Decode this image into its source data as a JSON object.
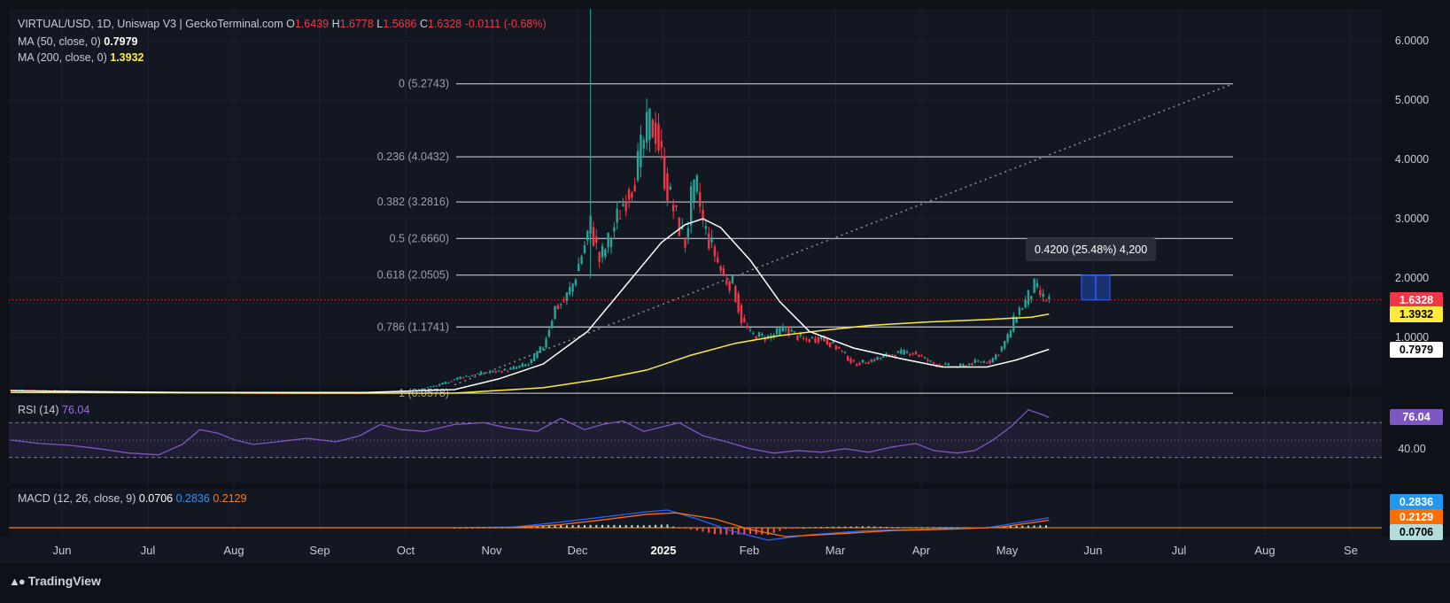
{
  "header": {
    "symbol": "VIRTUAL/USD, 1D, Uniswap V3 | GeckoTerminal.com",
    "ohlc": [
      {
        "k": "O",
        "v": "1.6439"
      },
      {
        "k": "H",
        "v": "1.6778"
      },
      {
        "k": "L",
        "v": "1.5686"
      },
      {
        "k": "C",
        "v": "1.6328"
      }
    ],
    "change": "-0.0111 (-0.68%)",
    "ma50_label": "MA (50, close, 0)",
    "ma50_value": "0.7979",
    "ma200_label": "MA (200, close, 0)",
    "ma200_value": "1.3932"
  },
  "rsi_panel": {
    "label": "RSI (14)",
    "value": "76.04"
  },
  "macd_panel": {
    "label": "MACD (12, 26, close, 9)",
    "macd": "0.0706",
    "signal": "0.2836",
    "hist": "0.2129"
  },
  "measure_tooltip": "0.4200 (25.48%) 4,200",
  "brand": "TradingView",
  "colors": {
    "up": "#26a69a",
    "down": "#f23645",
    "ma50": "#ffffff",
    "ma200": "#ffeb3b",
    "rsi": "#7e57c2",
    "macd": "#2962ff",
    "signal": "#ff6d00",
    "fib": "#b2b5be"
  },
  "chart_data": {
    "type": "candlestick",
    "timeframe": "1D",
    "x_ticks": [
      "Jun",
      "Jul",
      "Aug",
      "Sep",
      "Oct",
      "Nov",
      "Dec",
      "2025",
      "Feb",
      "Mar",
      "Apr",
      "May",
      "Jun",
      "Jul",
      "Aug",
      "Se"
    ],
    "y_ticks": [
      "6.0000",
      "5.0000",
      "4.0000",
      "3.0000",
      "2.0000",
      "1.0000"
    ],
    "last_price": "1.6328",
    "axis_tags": [
      {
        "value": "1.6328",
        "bg": "#f23645",
        "fg": "#ffffff"
      },
      {
        "value": "1.3932",
        "bg": "#ffeb3b",
        "fg": "#000000"
      },
      {
        "value": "0.7979",
        "bg": "#ffffff",
        "fg": "#000000"
      }
    ],
    "fib_levels": [
      {
        "label": "0 (5.2743)",
        "value": 5.2743
      },
      {
        "label": "0.236 (4.0432)",
        "value": 4.0432
      },
      {
        "label": "0.382 (3.2816)",
        "value": 3.2816
      },
      {
        "label": "0.5 (2.6660)",
        "value": 2.666
      },
      {
        "label": "0.618 (2.0505)",
        "value": 2.0505
      },
      {
        "label": "0.786 (1.1741)",
        "value": 1.1741
      },
      {
        "label": "1 (0.0578)",
        "value": 0.0578
      }
    ],
    "price_path": [
      [
        0,
        0.12
      ],
      [
        30,
        0.09
      ],
      [
        60,
        0.07
      ],
      [
        90,
        0.06
      ],
      [
        120,
        0.06
      ],
      [
        135,
        0.09
      ],
      [
        145,
        0.2
      ],
      [
        152,
        0.33
      ],
      [
        160,
        0.4
      ],
      [
        168,
        0.45
      ],
      [
        175,
        0.55
      ],
      [
        180,
        0.85
      ],
      [
        184,
        1.5
      ],
      [
        187,
        1.6
      ],
      [
        190,
        1.9
      ],
      [
        193,
        2.4
      ],
      [
        196,
        2.9
      ],
      [
        199,
        2.3
      ],
      [
        202,
        2.6
      ],
      [
        205,
        3.0
      ],
      [
        208,
        3.4
      ],
      [
        210,
        3.6
      ],
      [
        212,
        3.9
      ],
      [
        214,
        4.3
      ],
      [
        216,
        4.6
      ],
      [
        218,
        4.5
      ],
      [
        220,
        4.0
      ],
      [
        222,
        3.5
      ],
      [
        225,
        3.0
      ],
      [
        228,
        2.6
      ],
      [
        230,
        3.3
      ],
      [
        232,
        3.5
      ],
      [
        234,
        2.9
      ],
      [
        238,
        2.4
      ],
      [
        241,
        2.0
      ],
      [
        244,
        1.9
      ],
      [
        247,
        1.3
      ],
      [
        250,
        1.05
      ],
      [
        256,
        1.0
      ],
      [
        262,
        1.15
      ],
      [
        268,
        0.95
      ],
      [
        274,
        1.0
      ],
      [
        280,
        0.8
      ],
      [
        285,
        0.55
      ],
      [
        290,
        0.6
      ],
      [
        298,
        0.72
      ],
      [
        305,
        0.75
      ],
      [
        312,
        0.55
      ],
      [
        320,
        0.5
      ],
      [
        326,
        0.58
      ],
      [
        331,
        0.6
      ],
      [
        334,
        0.75
      ],
      [
        337,
        1.0
      ],
      [
        340,
        1.4
      ],
      [
        343,
        1.6
      ],
      [
        346,
        1.85
      ],
      [
        349,
        1.65
      ],
      [
        351,
        1.6328
      ]
    ],
    "ma50_path": [
      [
        0,
        0.1
      ],
      [
        60,
        0.07
      ],
      [
        120,
        0.07
      ],
      [
        150,
        0.12
      ],
      [
        165,
        0.3
      ],
      [
        180,
        0.55
      ],
      [
        195,
        1.1
      ],
      [
        210,
        2.0
      ],
      [
        220,
        2.6
      ],
      [
        228,
        2.9
      ],
      [
        234,
        3.0
      ],
      [
        240,
        2.85
      ],
      [
        250,
        2.3
      ],
      [
        260,
        1.6
      ],
      [
        270,
        1.1
      ],
      [
        285,
        0.82
      ],
      [
        300,
        0.65
      ],
      [
        315,
        0.5
      ],
      [
        330,
        0.5
      ],
      [
        340,
        0.62
      ],
      [
        351,
        0.7979
      ]
    ],
    "ma200_path": [
      [
        0,
        0.07
      ],
      [
        100,
        0.06
      ],
      [
        150,
        0.06
      ],
      [
        180,
        0.15
      ],
      [
        200,
        0.3
      ],
      [
        215,
        0.45
      ],
      [
        230,
        0.7
      ],
      [
        245,
        0.9
      ],
      [
        260,
        1.03
      ],
      [
        275,
        1.12
      ],
      [
        290,
        1.2
      ],
      [
        310,
        1.26
      ],
      [
        330,
        1.3
      ],
      [
        345,
        1.34
      ],
      [
        351,
        1.3932
      ]
    ],
    "rsi": {
      "value": 76.04,
      "ticks": [
        "40.00"
      ],
      "upper": 70,
      "lower": 30,
      "path": [
        [
          0,
          50
        ],
        [
          10,
          46
        ],
        [
          20,
          44
        ],
        [
          30,
          40
        ],
        [
          40,
          35
        ],
        [
          50,
          33
        ],
        [
          58,
          45
        ],
        [
          64,
          62
        ],
        [
          70,
          58
        ],
        [
          76,
          50
        ],
        [
          82,
          45
        ],
        [
          90,
          48
        ],
        [
          100,
          52
        ],
        [
          110,
          48
        ],
        [
          118,
          55
        ],
        [
          125,
          68
        ],
        [
          132,
          62
        ],
        [
          140,
          60
        ],
        [
          150,
          68
        ],
        [
          160,
          70
        ],
        [
          168,
          64
        ],
        [
          178,
          60
        ],
        [
          186,
          75
        ],
        [
          194,
          62
        ],
        [
          200,
          68
        ],
        [
          207,
          72
        ],
        [
          214,
          60
        ],
        [
          220,
          65
        ],
        [
          226,
          70
        ],
        [
          234,
          55
        ],
        [
          242,
          48
        ],
        [
          250,
          40
        ],
        [
          258,
          35
        ],
        [
          266,
          38
        ],
        [
          274,
          36
        ],
        [
          282,
          40
        ],
        [
          290,
          36
        ],
        [
          298,
          42
        ],
        [
          306,
          46
        ],
        [
          312,
          38
        ],
        [
          320,
          35
        ],
        [
          326,
          38
        ],
        [
          332,
          50
        ],
        [
          338,
          65
        ],
        [
          344,
          85
        ],
        [
          349,
          79
        ],
        [
          351,
          76.04
        ]
      ]
    },
    "macd": {
      "macd_value": 0.0706,
      "signal_value": 0.2836,
      "hist_value": 0.2129,
      "macd_path": [
        [
          0,
          0
        ],
        [
          150,
          0
        ],
        [
          170,
          0.02
        ],
        [
          185,
          0.15
        ],
        [
          200,
          0.3
        ],
        [
          215,
          0.45
        ],
        [
          222,
          0.5
        ],
        [
          232,
          0.25
        ],
        [
          244,
          -0.1
        ],
        [
          256,
          -0.35
        ],
        [
          270,
          -0.2
        ],
        [
          290,
          -0.08
        ],
        [
          310,
          -0.04
        ],
        [
          330,
          0
        ],
        [
          345,
          0.2
        ],
        [
          351,
          0.2836
        ]
      ],
      "signal_path": [
        [
          0,
          0
        ],
        [
          150,
          0
        ],
        [
          170,
          0.01
        ],
        [
          185,
          0.08
        ],
        [
          200,
          0.22
        ],
        [
          215,
          0.38
        ],
        [
          225,
          0.42
        ],
        [
          238,
          0.25
        ],
        [
          250,
          -0.05
        ],
        [
          262,
          -0.25
        ],
        [
          278,
          -0.18
        ],
        [
          298,
          -0.08
        ],
        [
          318,
          -0.04
        ],
        [
          335,
          0.02
        ],
        [
          351,
          0.2129
        ]
      ]
    }
  }
}
